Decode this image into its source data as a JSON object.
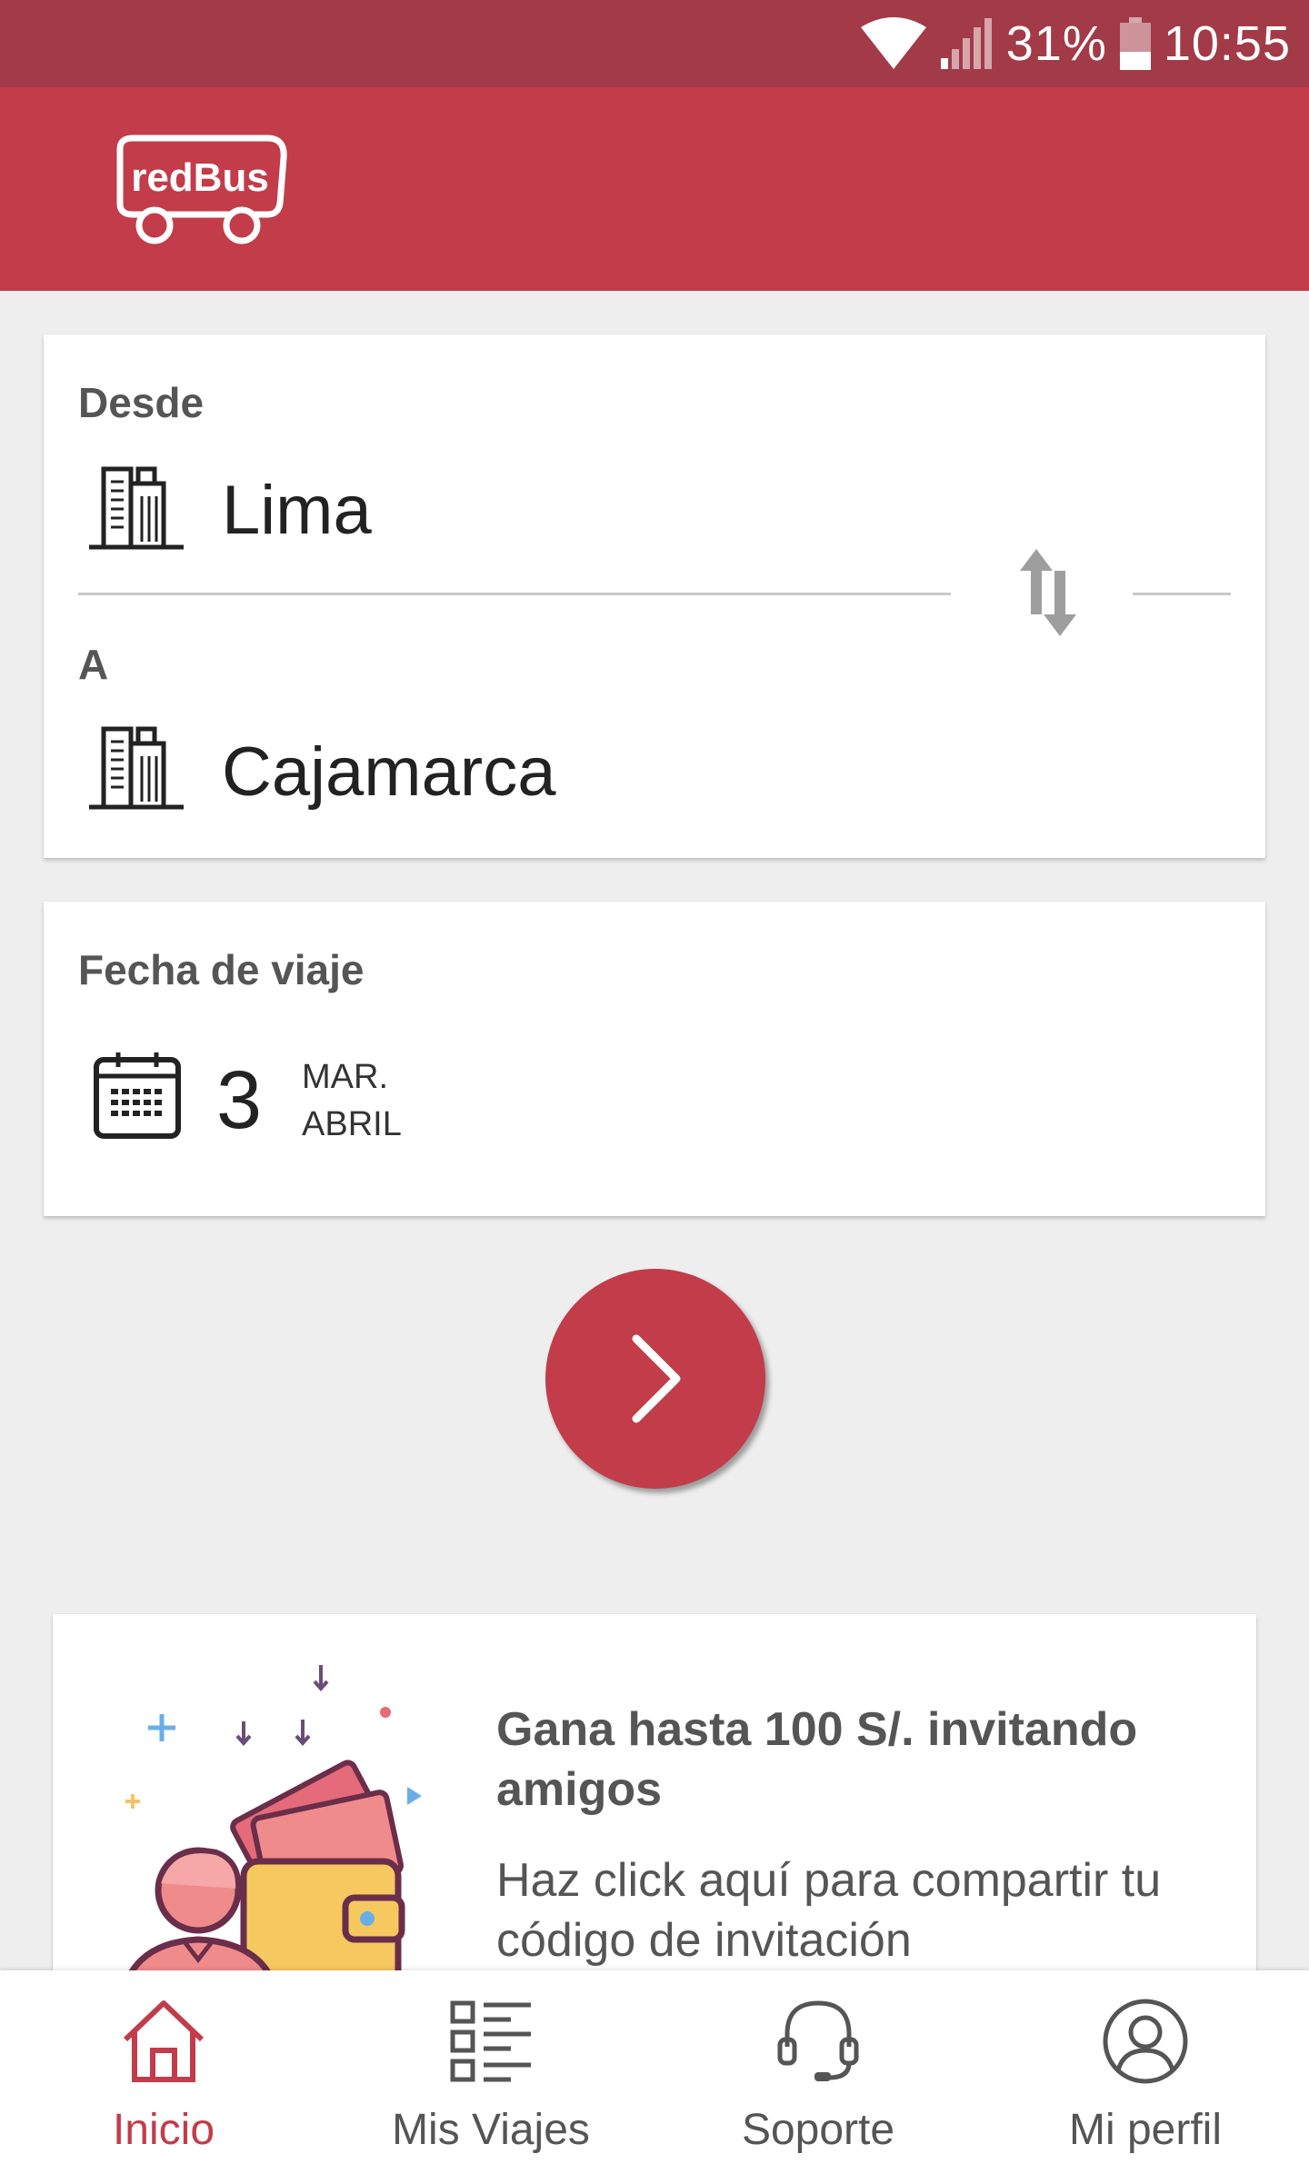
{
  "status_bar": {
    "battery": "31%",
    "time": "10:55"
  },
  "app": {
    "logo_text": "redBus"
  },
  "route": {
    "from_label": "Desde",
    "from_city": "Lima",
    "to_label": "A",
    "to_city": "Cajamarca"
  },
  "date": {
    "label": "Fecha de viaje",
    "day": "3",
    "weekday": "MAR.",
    "month": "ABRIL"
  },
  "promo": {
    "title": "Gana hasta 100 S/. invitando amigos",
    "subtitle": "Haz click aquí para compartir tu código de invitación"
  },
  "bottom_nav": [
    {
      "label": "Inicio",
      "icon": "home-icon"
    },
    {
      "label": "Mis Viajes",
      "icon": "list-icon"
    },
    {
      "label": "Soporte",
      "icon": "headset-icon"
    },
    {
      "label": "Mi perfil",
      "icon": "profile-icon"
    }
  ],
  "colors": {
    "brand": "#c23c4a",
    "status_bar": "#a23b47",
    "background": "#eeeeee"
  }
}
